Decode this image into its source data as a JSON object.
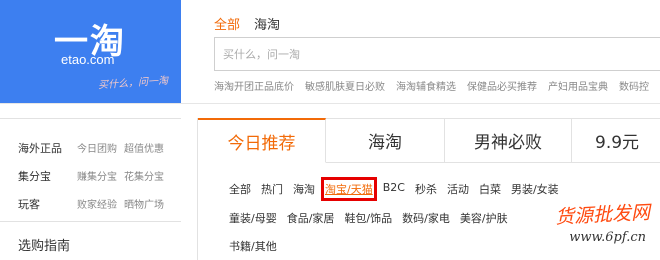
{
  "logo": {
    "mark": "一淘",
    "domain": "etao.com",
    "slogan": "买什么，问一淘",
    "brand_color": "#3d7ff0"
  },
  "search": {
    "tabs": [
      "全部",
      "海淘"
    ],
    "active_tab": 0,
    "placeholder": "买什么，问一淘",
    "accent_color": "#f26a08"
  },
  "hot_keywords": [
    "海淘开团正品底价",
    "敏感肌肤夏日必败",
    "海淘辅食精选",
    "保健品必买推荐",
    "产妇用品宝典",
    "数码控"
  ],
  "sidebar": {
    "rows": [
      {
        "category": "海外正品",
        "subs": [
          "今日团购",
          "超值优惠"
        ]
      },
      {
        "category": "集分宝",
        "subs": [
          "赚集分宝",
          "花集分宝"
        ]
      },
      {
        "category": "玩客",
        "subs": [
          "败家经验",
          "晒物广场"
        ]
      }
    ],
    "guide": "选购指南"
  },
  "main": {
    "tabs": [
      "今日推荐",
      "海淘",
      "男神必败",
      "9.9元"
    ],
    "active_tab": 0,
    "filter_rows": [
      [
        "全部",
        "热门",
        "海淘",
        "淘宝/天猫",
        "B2C",
        "秒杀",
        "活动",
        "白菜",
        "男装/女装"
      ],
      [
        "童装/母婴",
        "食品/家居",
        "鞋包/饰品",
        "数码/家电",
        "美容/护肤"
      ],
      [
        "书籍/其他"
      ]
    ],
    "highlighted_filter": "淘宝/天猫"
  },
  "watermark": {
    "text": "货源批发网",
    "url": "www.6pf.cn"
  }
}
